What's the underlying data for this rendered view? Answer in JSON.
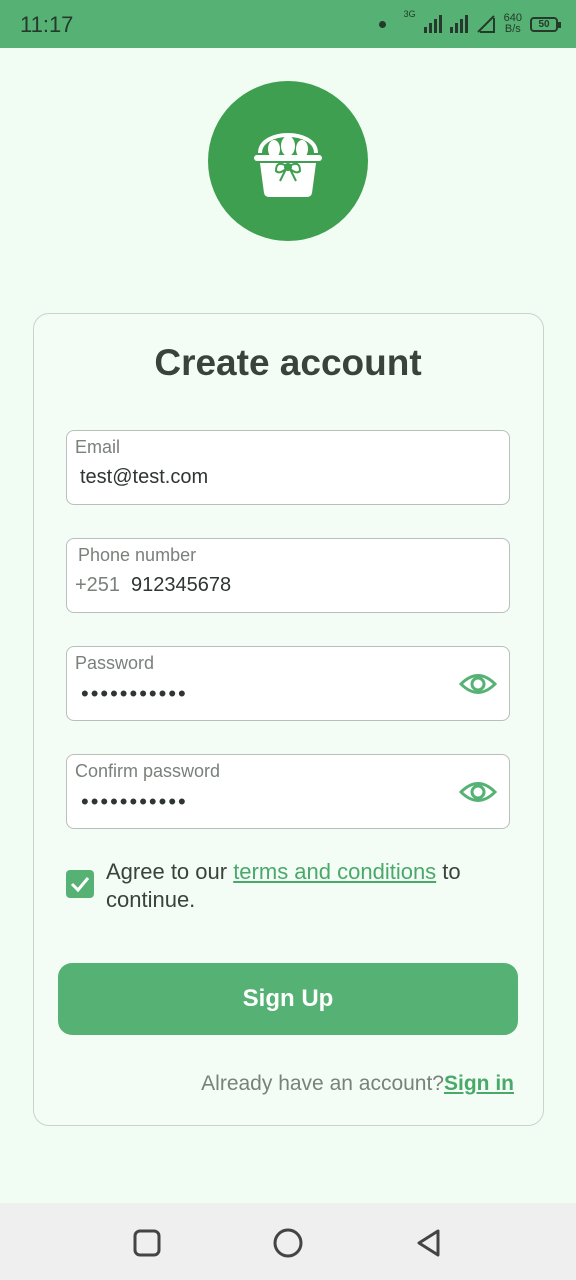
{
  "status_bar": {
    "time": "11:17",
    "network_type": "3G",
    "net_speed_value": "640",
    "net_speed_unit": "B/s",
    "battery": "50"
  },
  "logo": {
    "icon": "basket-icon"
  },
  "form": {
    "title": "Create account",
    "email": {
      "label": "Email",
      "value": "test@test.com"
    },
    "phone": {
      "label": "Phone number",
      "prefix": "+251",
      "value": "912345678"
    },
    "password": {
      "label": "Password",
      "value": "•••••••••••"
    },
    "confirm_password": {
      "label": "Confirm password",
      "value": "•••••••••••"
    },
    "agree": {
      "checked": true,
      "prefix": "Agree to our ",
      "link": "terms and conditions",
      "suffix": " to continue."
    },
    "submit_label": "Sign Up",
    "already_text": "Already have an account?",
    "signin_label": "Sign in"
  },
  "colors": {
    "primary": "#56b274",
    "logo_bg": "#3f9f50",
    "background": "#f1fcf3"
  },
  "nav_bar": {
    "icons": [
      "square-icon",
      "circle-icon",
      "triangle-back-icon"
    ]
  }
}
